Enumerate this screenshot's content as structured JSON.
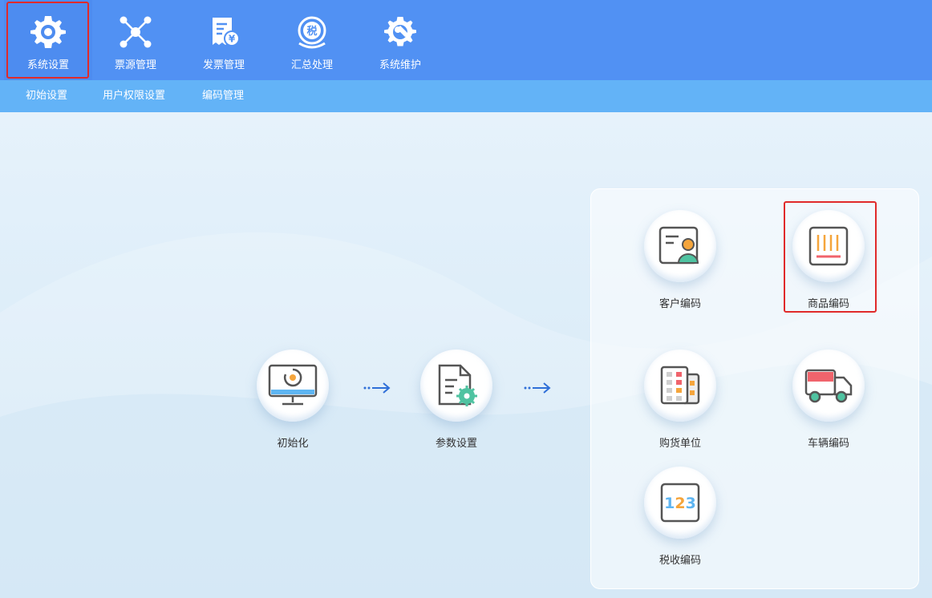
{
  "toolbar": {
    "items": [
      {
        "label": "系统设置",
        "icon": "gear-icon"
      },
      {
        "label": "票源管理",
        "icon": "network-icon"
      },
      {
        "label": "发票管理",
        "icon": "invoice-icon"
      },
      {
        "label": "汇总处理",
        "icon": "tax-summary-icon"
      },
      {
        "label": "系统维护",
        "icon": "wrench-gear-icon"
      }
    ],
    "active_index": 0
  },
  "subnav": {
    "items": [
      {
        "label": "初始设置"
      },
      {
        "label": "用户权限设置"
      },
      {
        "label": "编码管理"
      }
    ]
  },
  "workflow": {
    "steps": [
      {
        "label": "初始化",
        "icon": "monitor-icon"
      },
      {
        "label": "参数设置",
        "icon": "document-gear-icon"
      }
    ]
  },
  "coding_panel": {
    "items": [
      {
        "label": "客户编码",
        "icon": "customer-card-icon"
      },
      {
        "label": "商品编码",
        "icon": "barcode-icon"
      },
      {
        "label": "购货单位",
        "icon": "building-icon"
      },
      {
        "label": "车辆编码",
        "icon": "truck-icon"
      },
      {
        "label": "税收编码",
        "icon": "number-123-icon"
      }
    ],
    "tax_icon_digits": "123"
  },
  "tax_badge": "税",
  "colors": {
    "toolbar_bg": "#5191f3",
    "subnav_bg": "#63b3f7",
    "highlight_border": "#e02a2a"
  }
}
